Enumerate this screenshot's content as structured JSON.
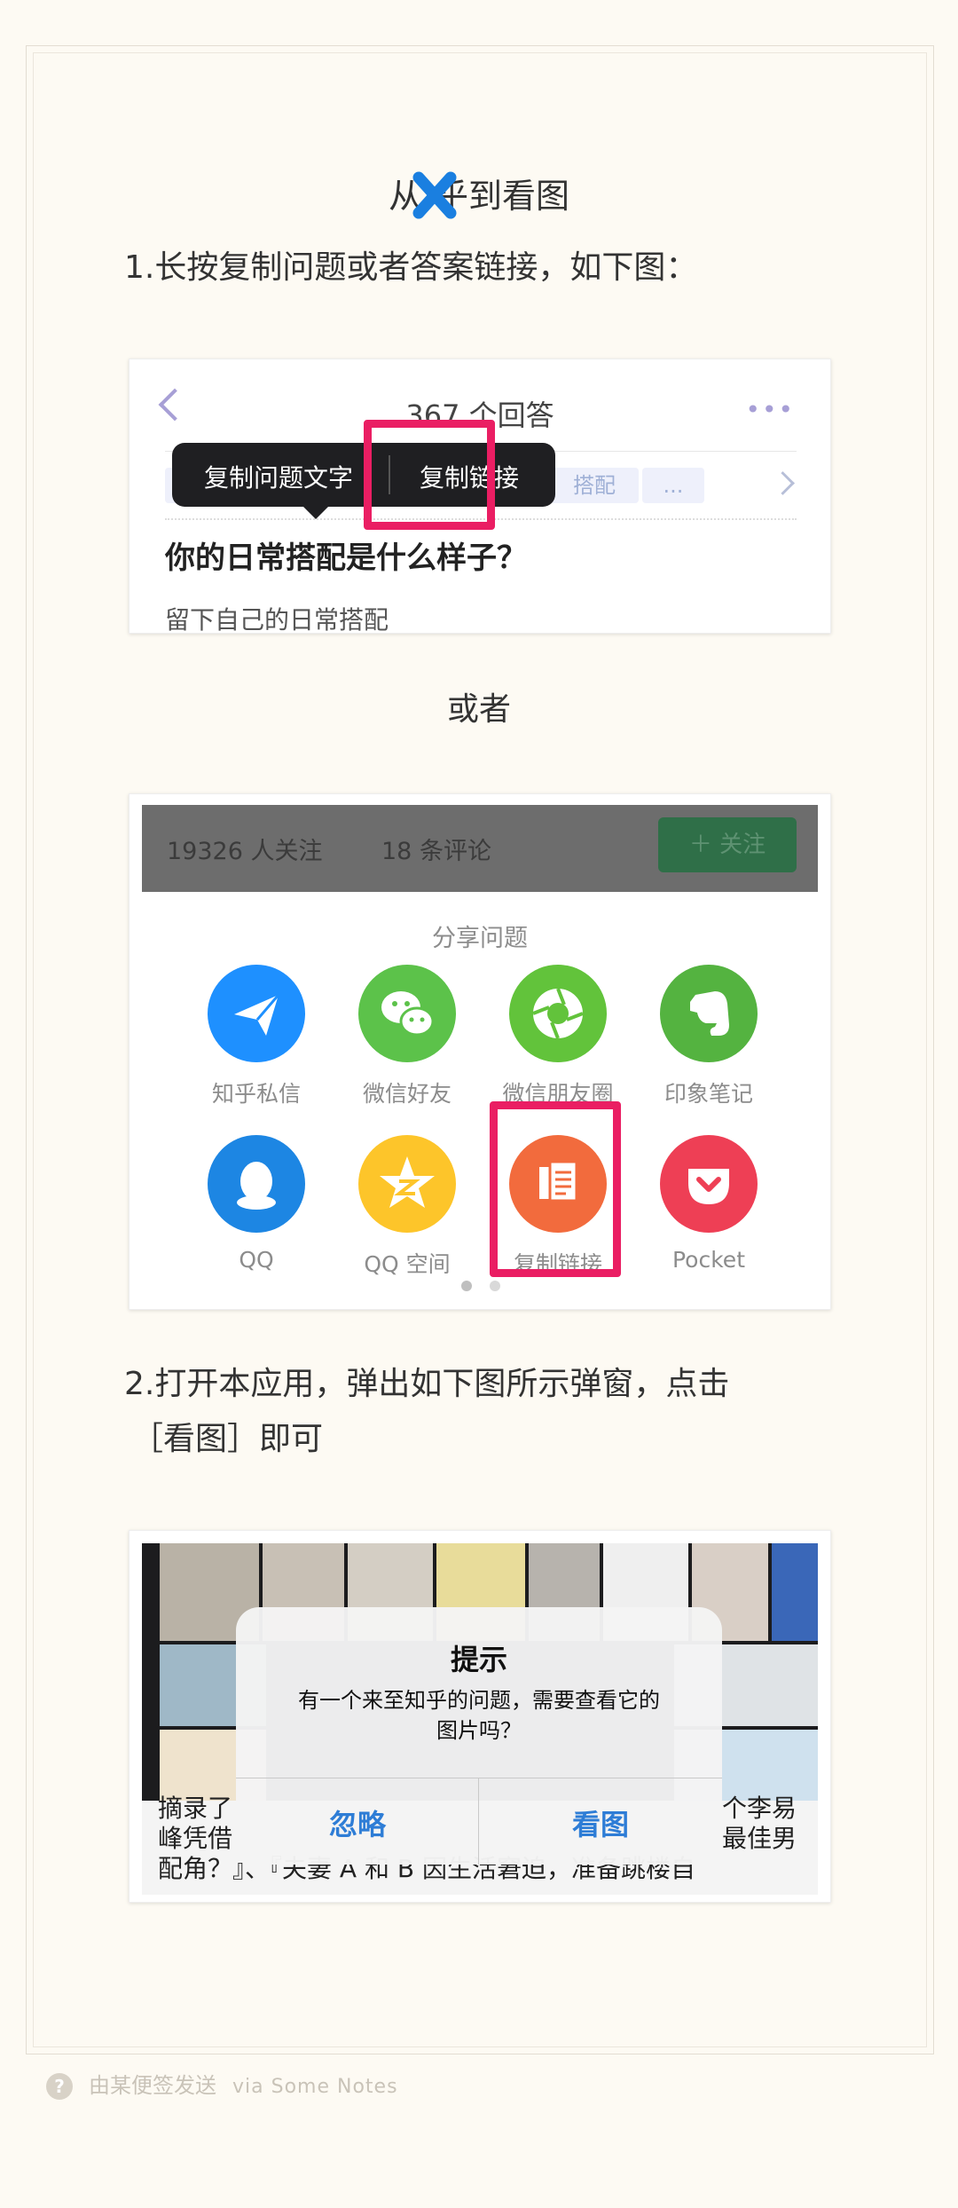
{
  "title": {
    "before": "从",
    "after": "乎到看图"
  },
  "step1": "1.长按复制问题或者答案链接，如下图：",
  "card1": {
    "header_title": "367 个回答",
    "popup_copy_text": "复制问题文字",
    "popup_copy_link": "复制链接",
    "tag_partial": "搭配",
    "tag_more": "...",
    "question": "你的日常搭配是什么样子？",
    "subtitle": "留下自己的日常搭配"
  },
  "or": "或者",
  "card2": {
    "followers": "19326 人关注",
    "comments": "18 条评论",
    "follow_button": "＋ 关注",
    "share_title": "分享问题",
    "items": [
      {
        "label": "知乎私信",
        "icon": "paper-plane-icon",
        "color": "#1e90ff"
      },
      {
        "label": "微信好友",
        "icon": "wechat-icon",
        "color": "#5cc24a"
      },
      {
        "label": "微信朋友圈",
        "icon": "wechat-moments-icon",
        "color": "#62c33b"
      },
      {
        "label": "印象笔记",
        "icon": "evernote-icon",
        "color": "#54b340"
      },
      {
        "label": "QQ",
        "icon": "qq-icon",
        "color": "#1d86e3"
      },
      {
        "label": "QQ 空间",
        "icon": "qzone-star-icon",
        "color": "#fdc52a"
      },
      {
        "label": "复制链接",
        "icon": "copy-link-icon",
        "color": "#f26b3d"
      },
      {
        "label": "Pocket",
        "icon": "pocket-icon",
        "color": "#ee3f55"
      }
    ]
  },
  "step2_line1": "2.打开本应用，弹出如下图所示弹窗，点击",
  "step2_line2": "［看图］即可",
  "card3": {
    "dialog_title": "提示",
    "dialog_msg_1": "有一个来至知乎的问题，需要查看它的",
    "dialog_msg_2": "图片吗？",
    "ignore_button": "忽略",
    "view_button": "看图",
    "bg_line1": "摘录了",
    "bg_line1_right": "个李易",
    "bg_line2": "峰凭借",
    "bg_line2_right": "最佳男",
    "bg_line3": "配角？』、『夫妻 A 和 B 因生活窘迫，准备跳楼自"
  },
  "footer": {
    "text": "由某便签发送",
    "via": "via Some Notes"
  }
}
